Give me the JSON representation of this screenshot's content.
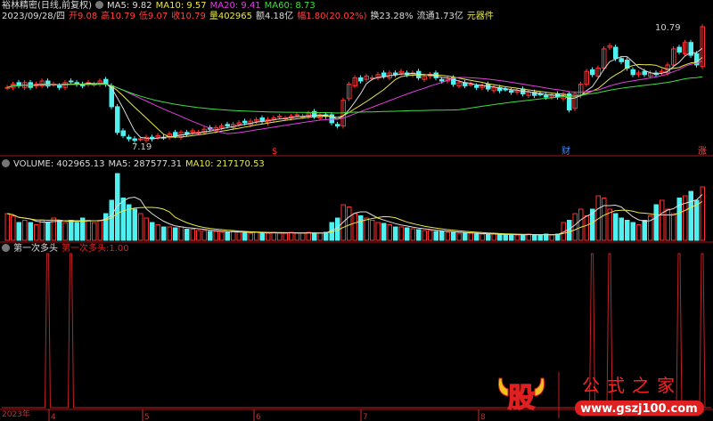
{
  "main": {
    "title": "裕林精密(日线,前复权)",
    "ma5": "MA5: 9.82",
    "ma10": "MA10: 9.57",
    "ma20": "MA20: 9.41",
    "ma60": "MA60: 8.73",
    "info": {
      "date": "2023/09/28/四",
      "open": "开9.08",
      "high": "高10.79",
      "low": "低9.07",
      "close": "收10.79",
      "vol": "量402965",
      "amount": "额4.18亿",
      "change": "幅1.80(20.02%)",
      "turnover": "换23.28%",
      "float": "流通1.73亿",
      "sector": "元器件"
    },
    "high_label": "10.79",
    "low_label": "7.19",
    "markers": [
      "$",
      "财",
      "涨"
    ]
  },
  "volume": {
    "label": "VOLUME: 402965.13",
    "ma5": "MA5: 287577.31",
    "ma10": "MA10: 217170.53"
  },
  "indicator": {
    "name": "第一次多头",
    "label": "第一次多头:",
    "value": "1.00"
  },
  "axis": {
    "year": "2023年",
    "months": [
      "4",
      "5",
      "6",
      "7",
      "8"
    ]
  },
  "watermark": {
    "logo": "股",
    "title": "公式之家",
    "url": "www.gszj100.com"
  },
  "chart_data": {
    "type": "candlestick",
    "closes": [
      8.9,
      9.0,
      8.95,
      9.05,
      8.9,
      9.0,
      9.1,
      8.95,
      9.0,
      8.9,
      9.05,
      9.1,
      9.0,
      8.95,
      9.05,
      9.0,
      9.1,
      9.0,
      8.3,
      7.5,
      7.4,
      7.3,
      7.25,
      7.3,
      7.35,
      7.3,
      7.4,
      7.35,
      7.45,
      7.4,
      7.5,
      7.45,
      7.55,
      7.5,
      7.6,
      7.6,
      7.65,
      7.7,
      7.7,
      7.75,
      7.8,
      7.8,
      7.85,
      7.9,
      7.85,
      7.9,
      7.95,
      8.0,
      7.95,
      8.0,
      8.05,
      8.0,
      8.1,
      8.0,
      8.05,
      8.0,
      7.8,
      7.7,
      8.5,
      9.0,
      9.2,
      9.1,
      9.25,
      9.2,
      9.3,
      9.25,
      9.35,
      9.3,
      9.4,
      9.3,
      9.35,
      9.2,
      9.25,
      9.3,
      9.2,
      9.1,
      9.15,
      9.0,
      9.05,
      8.95,
      9.0,
      8.9,
      8.95,
      8.85,
      8.9,
      8.8,
      8.85,
      8.75,
      8.8,
      8.7,
      8.75,
      8.65,
      8.7,
      8.6,
      8.65,
      8.6,
      8.7,
      8.2,
      8.7,
      9.0,
      9.4,
      9.3,
      9.5,
      10.1,
      10.2,
      9.8,
      9.7,
      9.5,
      9.3,
      9.35,
      9.3,
      9.35,
      9.3,
      9.4,
      9.6,
      10.1,
      10.0,
      10.3,
      9.9,
      9.6,
      10.79
    ],
    "volumes": [
      60,
      55,
      40,
      45,
      40,
      35,
      45,
      40,
      50,
      45,
      40,
      45,
      40,
      50,
      45,
      40,
      45,
      60,
      90,
      150,
      95,
      80,
      70,
      60,
      50,
      40,
      35,
      30,
      30,
      28,
      30,
      25,
      25,
      22,
      22,
      20,
      20,
      18,
      18,
      20,
      18,
      18,
      16,
      18,
      16,
      16,
      18,
      16,
      16,
      18,
      16,
      16,
      18,
      16,
      16,
      18,
      40,
      50,
      80,
      75,
      60,
      55,
      50,
      45,
      40,
      38,
      35,
      30,
      30,
      28,
      26,
      24,
      22,
      22,
      20,
      20,
      18,
      18,
      16,
      16,
      16,
      14,
      14,
      14,
      14,
      12,
      12,
      14,
      12,
      12,
      14,
      12,
      12,
      14,
      12,
      14,
      40,
      45,
      60,
      70,
      55,
      70,
      100,
      95,
      70,
      60,
      50,
      45,
      40,
      35,
      45,
      55,
      80,
      90,
      70,
      60,
      95,
      100,
      110,
      90,
      120
    ],
    "signal_indices": [
      7,
      11,
      101,
      104,
      116,
      120
    ],
    "ylim": [
      7.19,
      10.79
    ]
  }
}
